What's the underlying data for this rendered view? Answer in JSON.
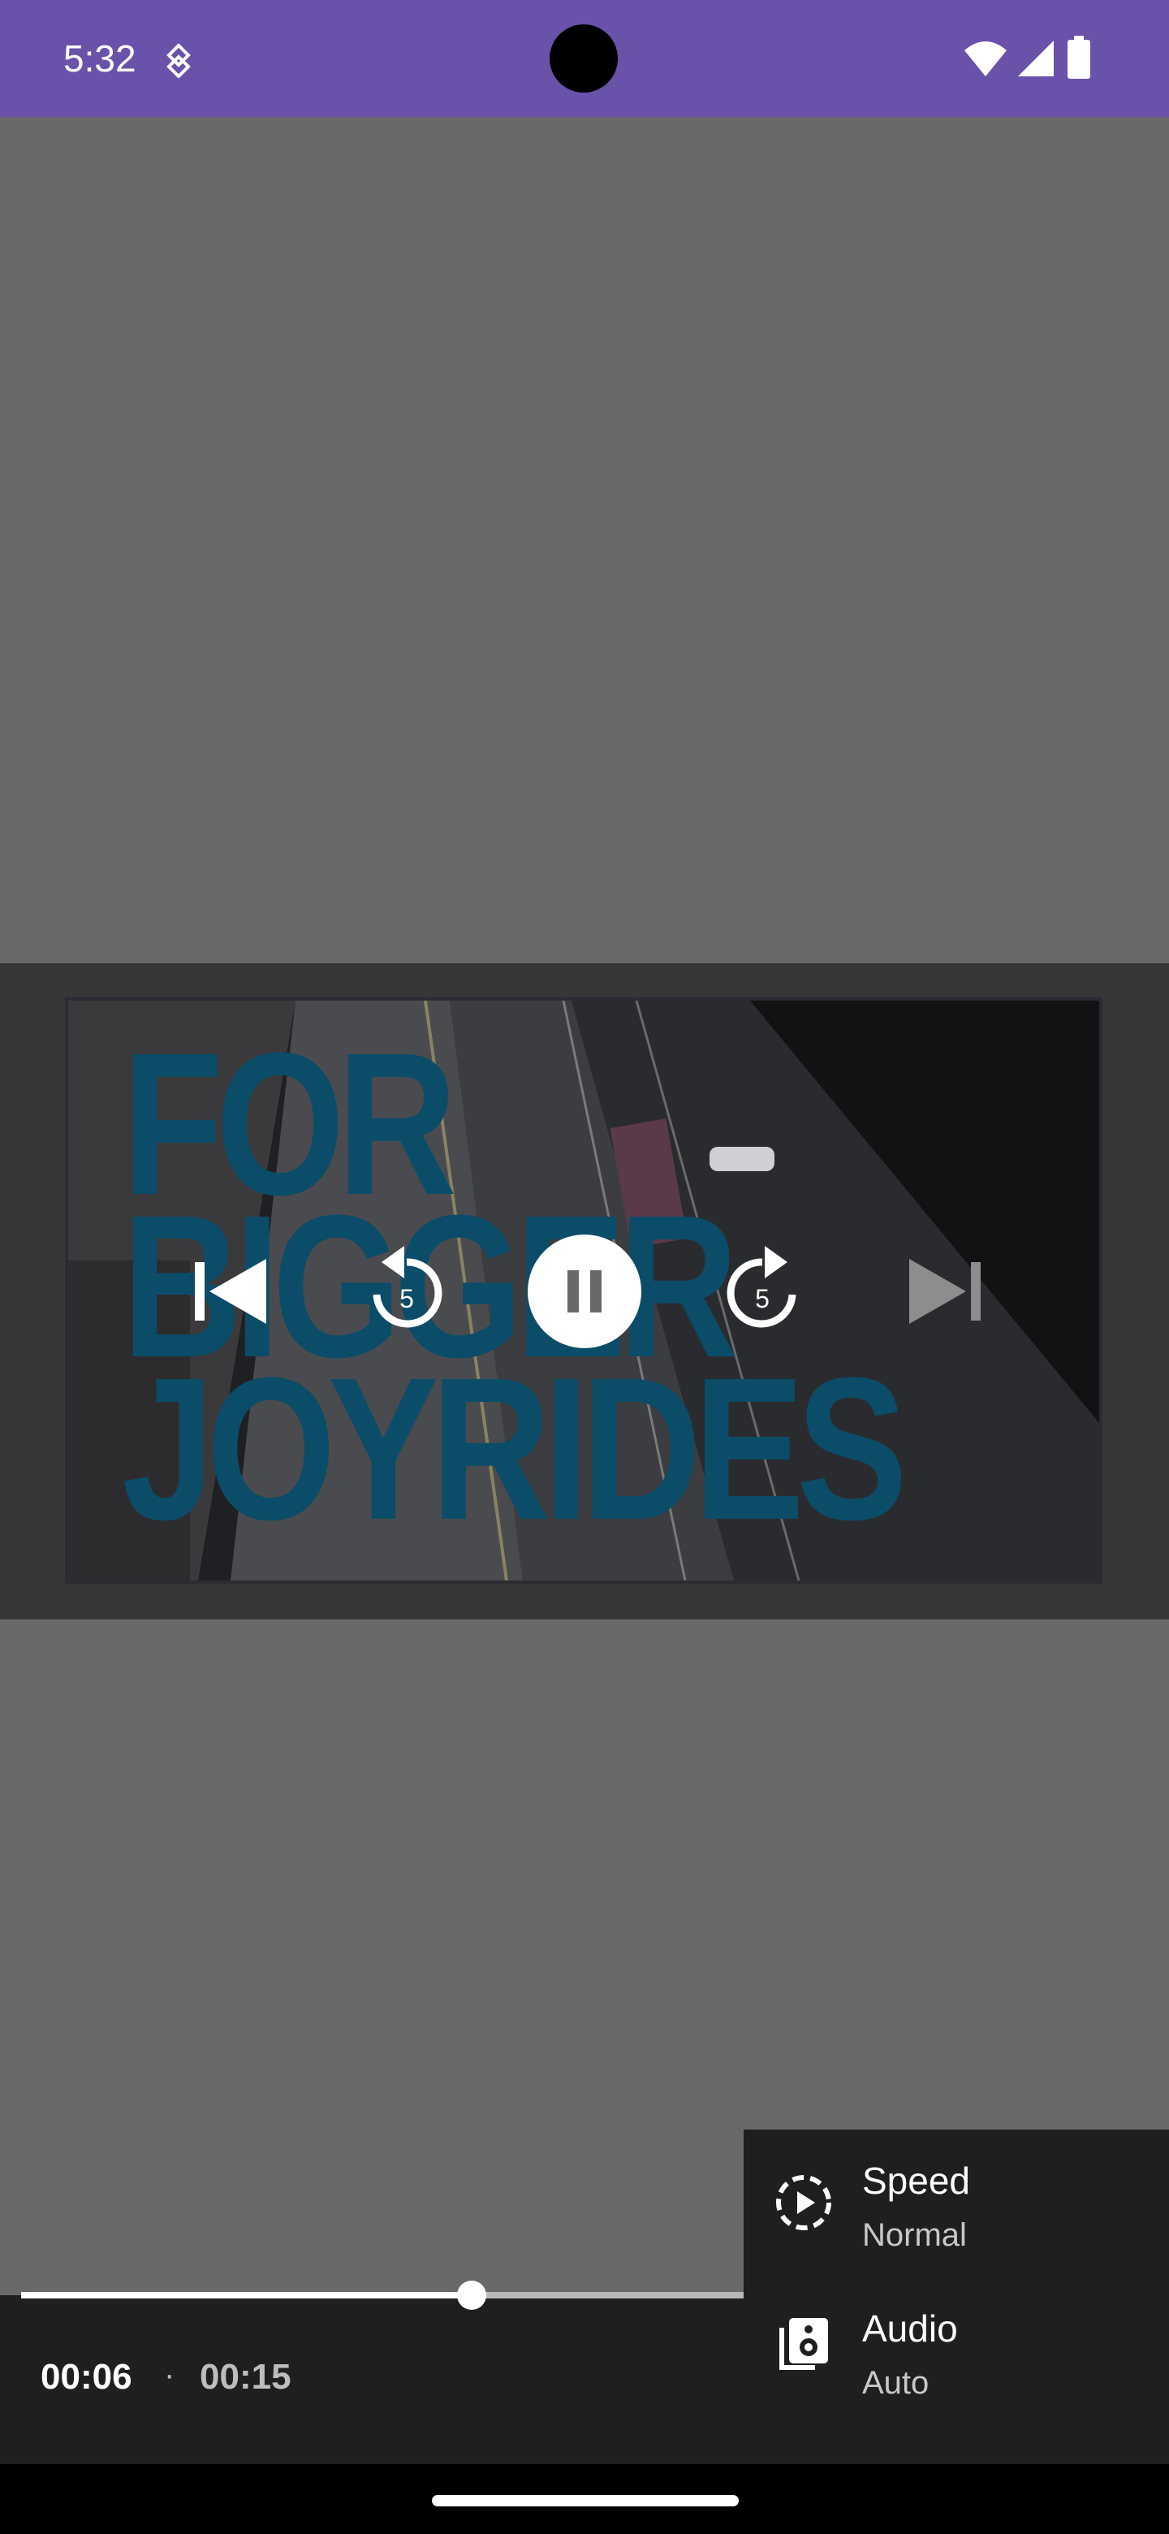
{
  "status_bar": {
    "time": "5:32",
    "background_color": "#6a51a9",
    "icons": [
      "sync-icon",
      "wifi-icon",
      "signal-icon",
      "battery-icon"
    ]
  },
  "video": {
    "title_lines": [
      "FOR",
      "BIGGER",
      "JOYRIDES"
    ],
    "title_color": "#0b4c68"
  },
  "controls": {
    "rewind_seconds": "5",
    "forward_seconds": "5",
    "icons": [
      "skip-previous-icon",
      "rewind-5-icon",
      "pause-icon",
      "forward-5-icon",
      "skip-next-icon"
    ]
  },
  "timeline": {
    "position": "00:06",
    "separator": "·",
    "duration": "00:15",
    "progress_fraction": 0.4
  },
  "settings_menu": {
    "items": [
      {
        "label": "Speed",
        "value": "Normal",
        "icon": "playback-speed-icon"
      },
      {
        "label": "Audio",
        "value": "Auto",
        "icon": "audio-track-icon"
      }
    ]
  }
}
